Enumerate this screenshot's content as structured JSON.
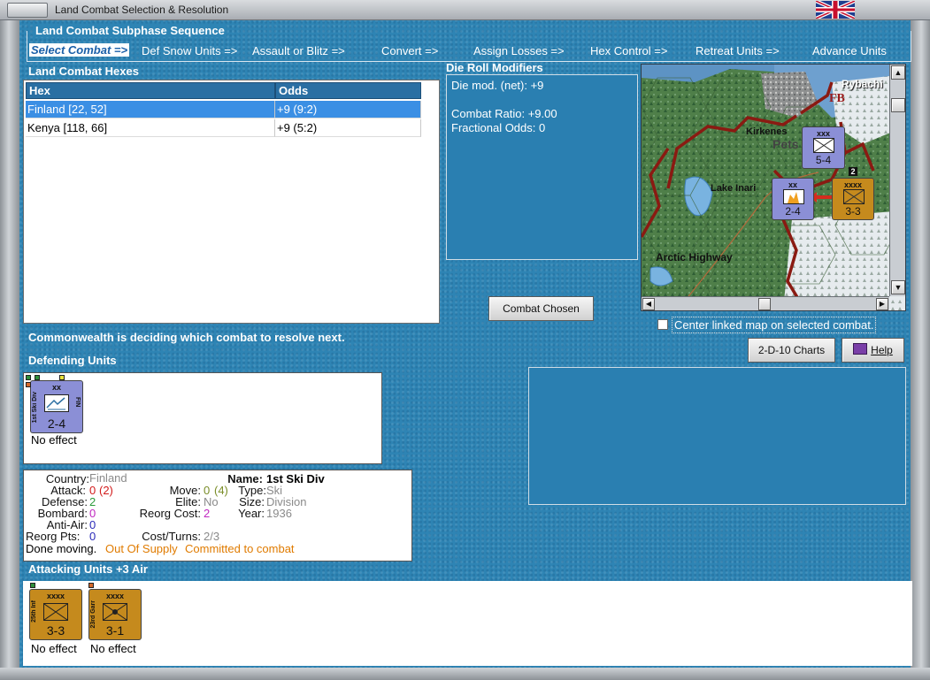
{
  "window": {
    "title": "Land Combat Selection & Resolution"
  },
  "subphase": {
    "title": "Land Combat Subphase Sequence",
    "steps": [
      "Select Combat =>",
      "Def Snow Units =>",
      "Assault or Blitz =>",
      "Convert =>",
      "Assign Losses =>",
      "Hex Control =>",
      "Retreat Units =>",
      "Advance Units"
    ]
  },
  "hexes": {
    "title": "Land Combat Hexes",
    "columns": [
      "Hex",
      "Odds"
    ],
    "rows": [
      {
        "hex": "Finland [22, 52]",
        "odds": "+9 (9:2)",
        "selected": true
      },
      {
        "hex": "Kenya [118, 66]",
        "odds": "+9 (5:2)",
        "selected": false
      }
    ]
  },
  "die_roll": {
    "title": "Die Roll Modifiers",
    "net": "Die mod. (net): +9",
    "ratio": "Combat Ratio: +9.00",
    "fractional": "Fractional Odds: 0"
  },
  "map": {
    "labels": {
      "rybachi": "Rybachi",
      "fb": "FB",
      "kirkenes": "Kirkenes",
      "pets": "Pets",
      "lake": "Lake Inari",
      "highway": "Arctic Highway"
    },
    "units": [
      {
        "size": "xxx",
        "str": "5-4"
      },
      {
        "size": "xx",
        "str": "2-4"
      },
      {
        "size": "xxxx",
        "str": "3-3"
      }
    ],
    "stack_badge": "2"
  },
  "buttons": {
    "combat_chosen": "Combat Chosen",
    "charts": "2-D-10 Charts",
    "help": "Help"
  },
  "center_linked": "Center linked map on selected combat.",
  "status": "Commonwealth is deciding which combat to resolve next.",
  "defending": {
    "title": "Defending Units",
    "units": [
      {
        "size": "xx",
        "name": "1st Ski Div",
        "nat": "FIN",
        "str": "2-4",
        "result": "No effect"
      }
    ]
  },
  "details": {
    "country_label": "Country:",
    "country": "Finland",
    "name_label": "Name:",
    "name": "1st Ski Div",
    "attack_label": "Attack:",
    "attack": "0",
    "attack_mod": "(2)",
    "move_label": "Move:",
    "move": "0",
    "move_mod": "(4)",
    "type_label": "Type:",
    "type": "Ski",
    "defense_label": "Defense:",
    "defense": "2",
    "elite_label": "Elite:",
    "elite": "No",
    "size_label": "Size:",
    "size": "Division",
    "bombard_label": "Bombard:",
    "bombard": "0",
    "reorg_cost_label": "Reorg Cost:",
    "reorg_cost": "2",
    "year_label": "Year:",
    "year": "1936",
    "antiair_label": "Anti-Air:",
    "antiair": "0",
    "reorg_pts_label": "Reorg Pts:",
    "reorg_pts": "0",
    "cost_turns_label": "Cost/Turns:",
    "cost_turns": "2/3",
    "done": "Done moving.",
    "supply": "Out Of Supply",
    "committed": "Committed to combat"
  },
  "attacking": {
    "title": "Attacking Units +3 Air",
    "units": [
      {
        "size": "xxxx",
        "name": "25th Inf",
        "str": "3-3",
        "result": "No effect"
      },
      {
        "size": "xxxx",
        "name": "23rd Garr",
        "str": "3-1",
        "result": "No effect"
      }
    ]
  },
  "colors": {
    "accent": "#2e84b4",
    "selected_row": "#3b8fe4",
    "unit_blue": "#8b8fd6",
    "unit_orange": "#c58a1d",
    "attack_red": "#d21a1a",
    "supply_orange": "#e07b00"
  }
}
